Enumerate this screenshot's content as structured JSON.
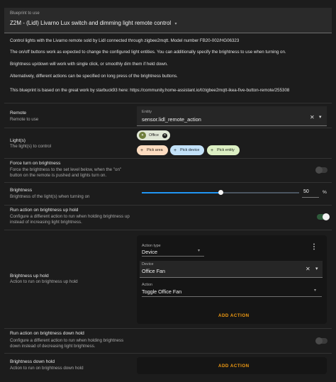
{
  "blueprint": {
    "label": "Blueprint to use",
    "value": "Z2M - (Lidl) Livarno Lux switch and dimming light remote control",
    "caret": "▾"
  },
  "description": [
    "Control lights with the Livarno remote sold by Lidl connected through zigbee2mqtt. Model number FB20-002/HG06323",
    "The on/off buttons work as expected to change the configured light entities. You can additionally specify the brightness to use when turning on.",
    "Brightness up/down will work with single click, or smoothly dim them if held down.",
    "Alternatively, different actions can be specified on long press of the brightness buttons.",
    "This blueprint is based on the great work by starbuck93 here: https://community.home-assistant.io/t/zigbee2mqtt-ikea-five-button-remote/255308"
  ],
  "remote": {
    "title": "Remote",
    "subtitle": "Remote to use",
    "field_label": "Entity",
    "field_value": "sensor.lidl_remote_action"
  },
  "lights": {
    "title": "Light(s)",
    "subtitle": "The light(s) to control",
    "selected_chip": "Office",
    "pick_area": "Pick area",
    "pick_device": "Pick device",
    "pick_entity": "Pick entity",
    "plus": "+",
    "remove": "✕",
    "bulb": "✦"
  },
  "force_on": {
    "title": "Force turn on brightness",
    "subtitle_1": "Force the brightness to the set level below, when the \"on\"",
    "subtitle_2": "button on the remote is pushed and lights turn on.",
    "enabled": false
  },
  "brightness": {
    "title": "Brightness",
    "subtitle": "Brightness of the light(s) when turning on",
    "value": "50",
    "unit": "%",
    "fraction": 0.5
  },
  "run_up": {
    "title": "Run action on brightness up hold",
    "subtitle_1": "Configure a different action to run when holding brightness up",
    "subtitle_2": "instead of increasing light brightness.",
    "enabled": true
  },
  "up_hold": {
    "title": "Brightness up hold",
    "subtitle": "Action to run on brightness up hold",
    "action_type_label": "Action type",
    "action_type_value": "Device",
    "device_label": "Device",
    "device_value": "Office Fan",
    "action_label": "Action",
    "action_value": "Toggle Office Fan",
    "add_action": "ADD ACTION"
  },
  "run_down": {
    "title": "Run action on brightness down hold",
    "subtitle_1": "Configure a different action to run when holding brightness",
    "subtitle_2": "down instead of decreasing light brightness.",
    "enabled": false
  },
  "down_hold": {
    "title": "Brightness down hold",
    "subtitle": "Action to run on brightness down hold",
    "add_action": "ADD ACTION"
  },
  "icons": {
    "close": "✕",
    "dropdown": "▾",
    "more": "⋮"
  },
  "colors": {
    "accent_orange": "#f39c12",
    "slider_blue": "#2196f3",
    "toggle_on": "#2d5a3a"
  }
}
